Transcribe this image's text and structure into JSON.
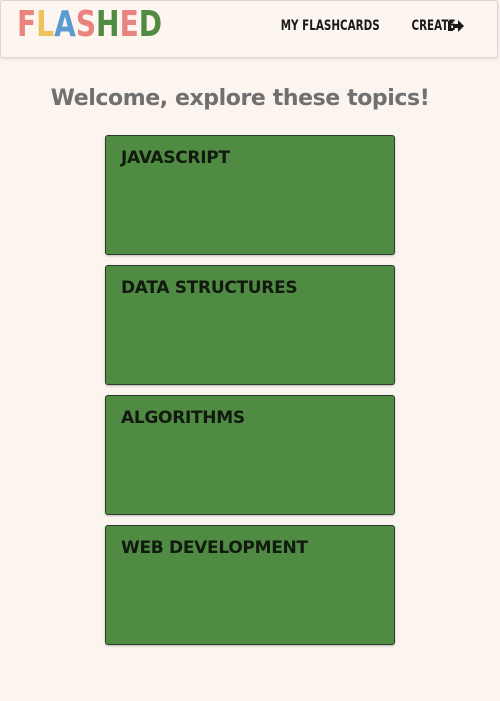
{
  "navbar": {
    "logo_letters": [
      {
        "char": "F",
        "color": "#e8837e"
      },
      {
        "char": "L",
        "color": "#f0c25d"
      },
      {
        "char": "A",
        "color": "#5a9bd0"
      },
      {
        "char": "S",
        "color": "#e8837e"
      },
      {
        "char": "H",
        "color": "#4f8b42"
      },
      {
        "char": "E",
        "color": "#e8837e"
      },
      {
        "char": "D",
        "color": "#4f8b42"
      }
    ],
    "links": {
      "my_flashcards": "MY FLASHCARDS",
      "create": "CREATE"
    },
    "logout_icon": "sign-out-icon"
  },
  "main": {
    "headline": "Welcome, explore these topics!",
    "topics": [
      {
        "title": "JAVASCRIPT"
      },
      {
        "title": "DATA STRUCTURES"
      },
      {
        "title": "ALGORITHMS"
      },
      {
        "title": "WEB DEVELOPMENT"
      }
    ]
  },
  "colors": {
    "background": "#fcf4ef",
    "card": "#4f8b42",
    "headline": "#707070"
  }
}
